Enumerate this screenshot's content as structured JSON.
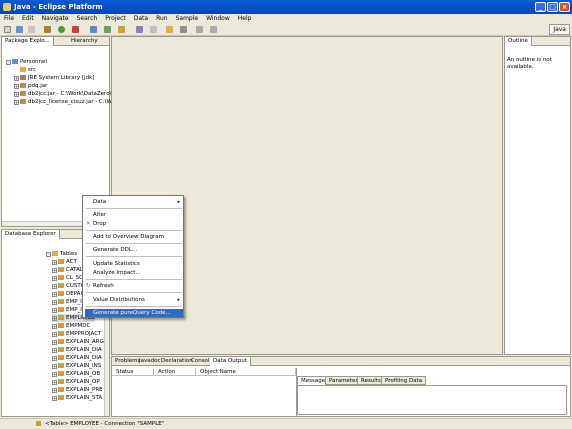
{
  "window": {
    "title": "Java - Eclipse Platform",
    "min": "_",
    "max": "□",
    "close": "×"
  },
  "menu": [
    "File",
    "Edit",
    "Navigate",
    "Search",
    "Project",
    "Data",
    "Run",
    "Sample",
    "Window",
    "Help"
  ],
  "perspective": "Java",
  "package_explorer": {
    "tabs": [
      "Package Explo...",
      "Hierarchy"
    ],
    "items": [
      {
        "label": "Personnel"
      },
      {
        "label": "src"
      },
      {
        "label": "JRE System Library [jdk]"
      },
      {
        "label": "pdq.jar"
      },
      {
        "label": "db2jcc.jar - C:\\Work\\DataZero\\j"
      },
      {
        "label": "db2jcc_license_cisuz.jar - C:\\Wo"
      }
    ]
  },
  "outline": {
    "tab": "Outline",
    "message": "An outline is not available."
  },
  "db_explorer": {
    "tab": "Database Explorer",
    "tables_label": "Tables",
    "items": [
      "ACT",
      "CATAL",
      "CL_SC",
      "CUSTO",
      "DEPAI",
      "EMP_I",
      "EMP_I",
      "EMPLOYEE",
      "EMPMDC",
      "EMPPROJACT",
      "EXPLAIN_ARG",
      "EXPLAIN_DIA",
      "EXPLAIN_DIA",
      "EXPLAIN_INS",
      "EXPLAIN_OB",
      "EXPLAIN_OP",
      "EXPLAIN_PRE",
      "EXPLAIN_STA"
    ]
  },
  "context_menu": {
    "items": [
      {
        "label": "Data",
        "submenu": true
      },
      {
        "label": "Alter"
      },
      {
        "label": "Drop"
      },
      {
        "label": "Add to Overview Diagram"
      },
      {
        "label": "Generate DDL..."
      },
      {
        "label": "Update Statistics"
      },
      {
        "label": "Analyze Impact..."
      },
      {
        "label": "Refresh"
      },
      {
        "label": "Value Distributions",
        "submenu": true
      },
      {
        "label": "Generate pureQuery Code..."
      }
    ],
    "submenu_arrow": "▸"
  },
  "bottom_panel": {
    "tabs": [
      "Problems",
      "Javadoc",
      "Declaration",
      "Console",
      "Data Output"
    ],
    "columns": [
      "Status",
      "Action",
      "Object Name"
    ],
    "right_tabs": [
      "Messages",
      "Parameters",
      "Results",
      "Profiling Data"
    ]
  },
  "status": "<Table> EMPLOYEE - Connection \"SAMPLE\""
}
